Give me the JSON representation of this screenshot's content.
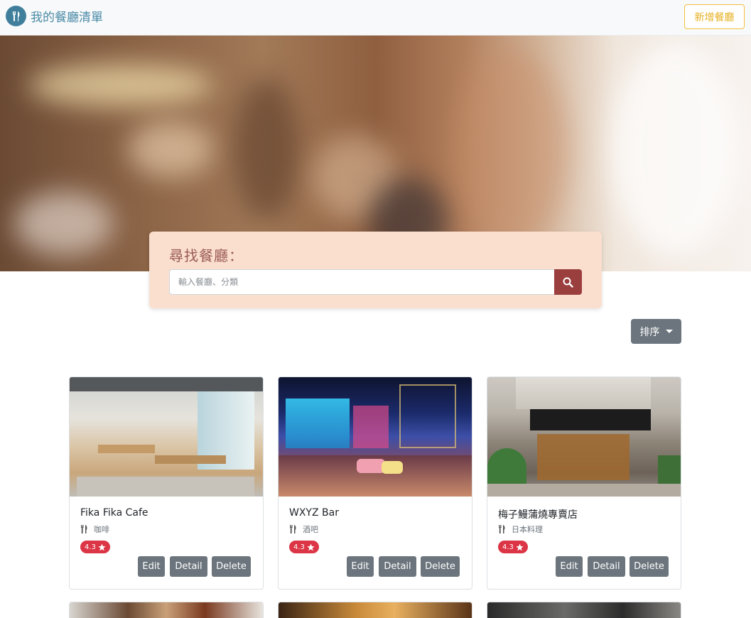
{
  "navbar": {
    "brand": "我的餐廳清單",
    "add_button": "新增餐廳"
  },
  "search": {
    "title": "尋找餐廳：",
    "placeholder": "輸入餐廳、分類"
  },
  "sort": {
    "label": "排序"
  },
  "restaurants": [
    {
      "name": "Fika Fika Cafe",
      "category": "咖啡",
      "rating": "4.3",
      "edit": "Edit",
      "detail": "Detail",
      "delete": "Delete"
    },
    {
      "name": "WXYZ Bar",
      "category": "酒吧",
      "rating": "4.3",
      "edit": "Edit",
      "detail": "Detail",
      "delete": "Delete"
    },
    {
      "name": "梅子鰻蒲燒專賣店",
      "category": "日本料理",
      "rating": "4.3",
      "edit": "Edit",
      "detail": "Detail",
      "delete": "Delete"
    }
  ],
  "colors": {
    "brand": "#4a8ba8",
    "add_button": "#f0c040",
    "search_button": "#9b3e3e",
    "badge": "#dc3545",
    "secondary_button": "#6c757d"
  }
}
